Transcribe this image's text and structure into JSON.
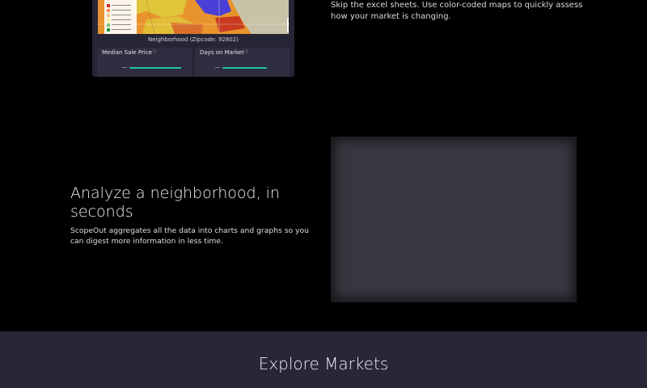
{
  "map_section": {
    "caption": "Neighborhood (Zipcode: 92802)",
    "zoom_in": "+",
    "zoom_out": "−",
    "legend_colors": [
      "#d7301f",
      "#fc8d59",
      "#fdcc8a",
      "#fef0a0",
      "#78c679",
      "#1a9641"
    ],
    "map_colors": {
      "orange": "#e8932d",
      "yellow": "#e0c43a",
      "blue": "#4a3fd6",
      "grey": "#c8c2a8",
      "red": "#c93a21"
    },
    "stats": [
      {
        "title": "Median Sale Price",
        "info": "ⓘ"
      },
      {
        "title": "Days on Market",
        "info": "ⓘ"
      }
    ],
    "description": "Skip the excel sheets. Use color-coded maps to quickly assess how your market is changing."
  },
  "analyze_section": {
    "title": "Analyze a neighborhood, in seconds",
    "description": "ScopeOut aggregates all the data into charts and graphs so you can digest more information in less time."
  },
  "explore_section": {
    "title": "Explore Markets"
  },
  "colors": {
    "background": "#000000",
    "card": "#262536",
    "band": "#282637",
    "accent": "#22c2a8"
  }
}
